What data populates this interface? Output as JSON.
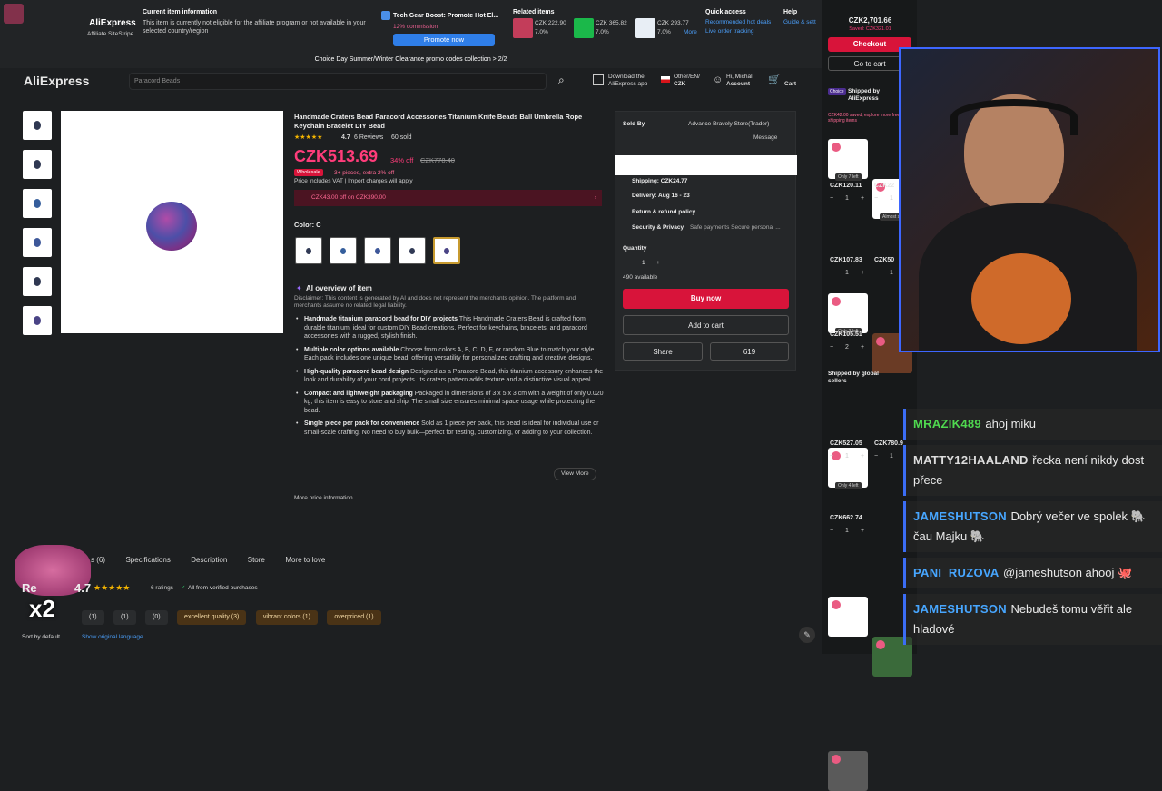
{
  "affiliate": {
    "logo": "AliExpress",
    "logo_sub": "Affiliate SiteStripe",
    "info_title": "Current item information",
    "info_text": "This item is currently not eligible for the affiliate program or not available in your selected country/region",
    "promo_title": "Tech Gear Boost: Promote Hot El...",
    "promo_commission": "12% commission",
    "promo_button": "Promote now",
    "related_title": "Related items",
    "related": [
      {
        "price": "CZK 222.90",
        "pct": "7.0%"
      },
      {
        "price": "CZK 365.82",
        "pct": "7.0%"
      },
      {
        "price": "CZK 293.77",
        "pct": "7.0%"
      }
    ],
    "more": "More",
    "quick_title": "Quick access",
    "quick_1": "Recommended hot deals",
    "quick_2": "Live order tracking",
    "help_title": "Help",
    "help_1": "Guide & sett",
    "banner": "Choice Day Summer/Winter Clearance promo codes collection > 2/2"
  },
  "header": {
    "logo": "AliExpress",
    "search_placeholder": "Paracord Beads",
    "app_label": "Download the AliExpress app",
    "region_top": "Other/EN/",
    "region_bottom": "CZK",
    "account_top": "Hi, Michal",
    "account_bottom": "Account",
    "cart": "Cart"
  },
  "product": {
    "title": "Handmade Craters Bead Paracord Accessories Titanium Knife Beads Ball Umbrella Rope Keychain Bracelet DIY Bead",
    "rating": "4.7",
    "reviews": "6 Reviews",
    "sold": "60 sold",
    "stars": "★★★★★",
    "price": "CZK513.69",
    "discount": "34% off",
    "old_price": "CZK778.40",
    "wholesale_badge": "Wholesale",
    "wholesale_text": "3+ pieces, extra 2% off",
    "vat": "Price includes VAT | Import charges will apply",
    "coupon": "CZK43.00 off on CZK390.00",
    "color_label": "Color: C",
    "ai_title": "AI overview of item",
    "disclaimer": "Disclaimer: This content is generated by AI and does not represent the merchants opinion. The platform and merchants assume no related legal liability.",
    "bullets": [
      {
        "head": "Handmade titanium paracord bead for DIY projects",
        "body": " This Handmade Craters Bead is crafted from durable titanium, ideal for custom DIY Bead creations. Perfect for keychains, bracelets, and paracord accessories with a rugged, stylish finish."
      },
      {
        "head": "Multiple color options available",
        "body": " Choose from colors A, B, C, D, F, or random Blue to match your style. Each pack includes one unique bead, offering versatility for personalized crafting and creative designs."
      },
      {
        "head": "High-quality paracord bead design",
        "body": " Designed as a Paracord Bead, this titanium accessory enhances the look and durability of your cord projects. Its craters pattern adds texture and a distinctive visual appeal."
      },
      {
        "head": "Compact and lightweight packaging",
        "body": " Packaged in dimensions of 3 x 5 x 3 cm with a weight of only 0.020 kg, this item is easy to store and ship. The small size ensures minimal space usage while protecting the bead."
      },
      {
        "head": "Single piece per pack for convenience",
        "body": " Sold as 1 piece per pack, this bead is ideal for individual use or small-scale crafting. No need to buy bulk—perfect for testing, customizing, or adding to your collection."
      }
    ],
    "view_more": "View More",
    "more_price_info": "More price information"
  },
  "seller": {
    "sold_by": "Sold By",
    "store": "Advance Bravely Store(Trader)",
    "message": "Message",
    "shipping": "Shipping: CZK24.77",
    "delivery": "Delivery: Aug 16 - 23",
    "returns": "Return & refund policy",
    "security": "Security & Privacy",
    "security_sub": "Safe payments Secure personal ...",
    "quantity_label": "Quantity",
    "quantity": "1",
    "available": "490 available",
    "buy_now": "Buy now",
    "add_to_cart": "Add to cart",
    "share": "Share",
    "wishlist": "619"
  },
  "bottom": {
    "tabs": [
      "s (6)",
      "Specifications",
      "Description",
      "Store",
      "More to love"
    ],
    "reviews_title": "Re",
    "rating": "4.7",
    "ratings_count": "6 ratings",
    "verified": "All from verified purchases",
    "filters": [
      {
        "label": "(1)",
        "type": "grey"
      },
      {
        "label": "(1)",
        "type": "grey"
      },
      {
        "label": "(0)",
        "type": "grey"
      },
      {
        "label": "excellent quality (3)",
        "type": "tag"
      },
      {
        "label": "vibrant colors (1)",
        "type": "tag"
      },
      {
        "label": "overpriced (1)",
        "type": "tag"
      }
    ],
    "sort": "Sort by default",
    "original_lang": "Show original language",
    "sticker": "x2"
  },
  "cart": {
    "total": "CZK2,701.66",
    "saved": "Saved: CZK321.01",
    "checkout": "Checkout",
    "go_to_cart": "Go to cart",
    "choice_badge": "Choice",
    "shipped_by_ali": "Shipped by AliExpress",
    "choice_saved": "CZK42.00 saved, explore more free shipping items",
    "items_ali": [
      {
        "price": "CZK120.11",
        "qty": "1",
        "note": "Only 7 left"
      },
      {
        "price": "CZK22",
        "qty": "1",
        "note": "Almost so"
      },
      {
        "price": "CZK107.83",
        "qty": "1",
        "note": "Only 3 left"
      },
      {
        "price": "CZK50",
        "qty": "1",
        "note": ""
      },
      {
        "price": "CZK105.51",
        "qty": "2",
        "note": "Only 4 left"
      }
    ],
    "shipped_global": "Shipped by global sellers",
    "items_global": [
      {
        "price": "CZK527.05",
        "qty": "1"
      },
      {
        "price": "CZK780.9",
        "qty": "1"
      },
      {
        "price": "CZK662.74",
        "qty": "1"
      }
    ]
  },
  "chat": [
    {
      "user": "MRAZIK489",
      "text": "ahoj miku",
      "color": "#4fd84f"
    },
    {
      "user": "MATTY12HAALAND",
      "text": "řecka není nikdy dost přece",
      "color": "#dddddd"
    },
    {
      "user": "JAMESHUTSON",
      "text": "Dobrý večer ve spolek 🐘 čau Majku 🐘",
      "color": "#47a6ff"
    },
    {
      "user": "PANI_RUZOVA",
      "text": "@jameshutson ahooj 🐙",
      "color": "#47a6ff"
    },
    {
      "user": "JAMESHUTSON",
      "text": "Nebudeš tomu věřit ale hladové",
      "color": "#47a6ff"
    }
  ],
  "colors": {
    "accent_red": "#d8143a",
    "price_pink": "#ff3c7a",
    "link_blue": "#4a9cf5"
  }
}
